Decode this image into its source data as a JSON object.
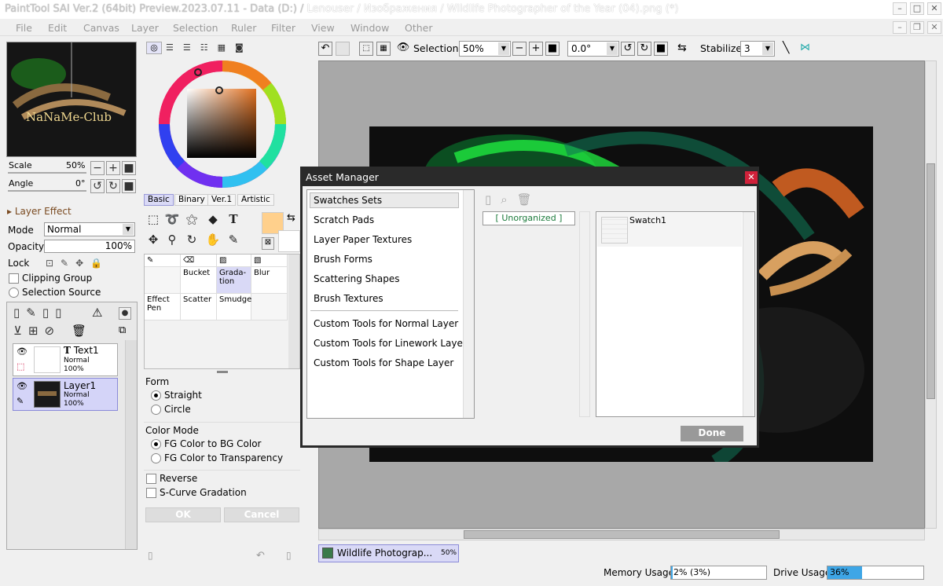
{
  "window": {
    "title_main": "PaintTool SAI Ver.2 (64bit) Preview.2023.07.11 - Data (D:) / ",
    "title_path": "Lenouser / Изображения / Wildlife Photographer of the Year (04).png (*)",
    "minimize": "–",
    "maximize": "□",
    "close": "✕"
  },
  "menu": [
    "File",
    "Edit",
    "Canvas",
    "Layer",
    "Selection",
    "Ruler",
    "Filter",
    "View",
    "Window",
    "Other"
  ],
  "navigator": {
    "logo_text": "NaNaMe-Club",
    "scale_label": "Scale",
    "scale_value": "50%",
    "angle_label": "Angle",
    "angle_value": "0°"
  },
  "layer_panel": {
    "section_title": "Layer Effect",
    "mode_label": "Mode",
    "mode_value": "Normal",
    "opacity_label": "Opacity",
    "opacity_value": "100%",
    "lock_label": "Lock",
    "clipping_label": "Clipping Group",
    "selection_source_label": "Selection Source",
    "layers": [
      {
        "name": "Text1",
        "mode": "Normal",
        "opacity": "100%"
      },
      {
        "name": "Layer1",
        "mode": "Normal",
        "opacity": "100%"
      }
    ]
  },
  "color_tabs": [
    "Basic",
    "Binary",
    "Ver.1",
    "Artistic"
  ],
  "brush_cells": {
    "bucket": "Bucket",
    "gradation": "Grada-\ntion",
    "blur": "Blur",
    "effect_pen": "Effect\nPen",
    "scatter": "Scatter",
    "smudge": "Smudge"
  },
  "gradation": {
    "form_label": "Form",
    "straight": "Straight",
    "circle": "Circle",
    "color_mode_label": "Color Mode",
    "fg_to_bg": "FG Color to BG Color",
    "fg_to_transparency": "FG Color to Transparency",
    "reverse": "Reverse",
    "s_curve": "S-Curve Gradation",
    "ok": "OK",
    "cancel": "Cancel"
  },
  "toolbar": {
    "selection_label": "Selection",
    "zoom_value": "50%",
    "rotation_value": "0.0°",
    "stabilizer_label": "Stabilizer",
    "stabilizer_value": "3"
  },
  "asset_manager": {
    "title": "Asset Manager",
    "categories": [
      "Swatches Sets",
      "Scratch Pads",
      "Layer Paper Textures",
      "Brush Forms",
      "Scattering Shapes",
      "Brush Textures"
    ],
    "custom_tools": [
      "Custom Tools for Normal Layer",
      "Custom Tools for Linework Layer",
      "Custom Tools for Shape Layer"
    ],
    "group_label": "[ Unorganized ]",
    "item_label": "Swatch1",
    "done": "Done"
  },
  "doc_tab": {
    "name": "Wildlife Photograp...",
    "zoom": "50%"
  },
  "status": {
    "memory_label": "Memory Usage",
    "memory_value": "2% (3%)",
    "memory_fraction": 0.02,
    "drive_label": "Drive Usage",
    "drive_value": "36%",
    "drive_fraction": 0.36
  },
  "colors": {
    "accent": "#2a2a2a",
    "drive_bar": "#3ea6e6",
    "selected": "#d4d4f8",
    "fg_swatch": "#ffd08c"
  }
}
